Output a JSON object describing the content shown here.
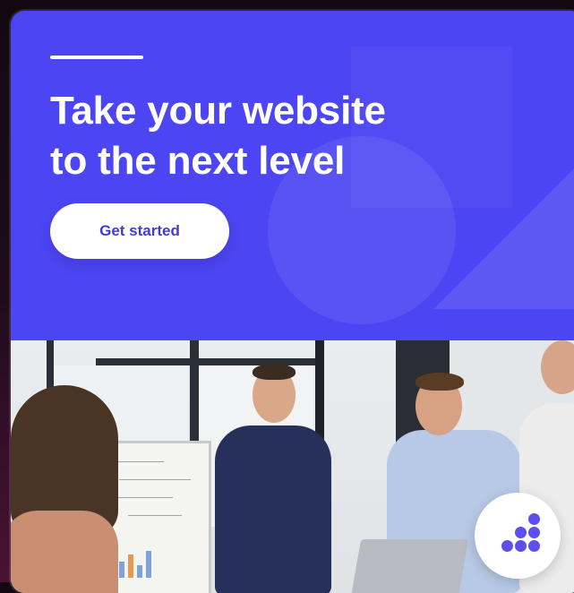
{
  "hero": {
    "headline_line1": "Take your website",
    "headline_line2": "to the next level",
    "cta_label": "Get started",
    "background_color": "#4c45f3",
    "accent_color": "#ffffff"
  },
  "photo": {
    "subject": "meeting-photo"
  },
  "brand_badge": {
    "icon": "dots-logo-icon",
    "color": "#5b4ff0"
  }
}
